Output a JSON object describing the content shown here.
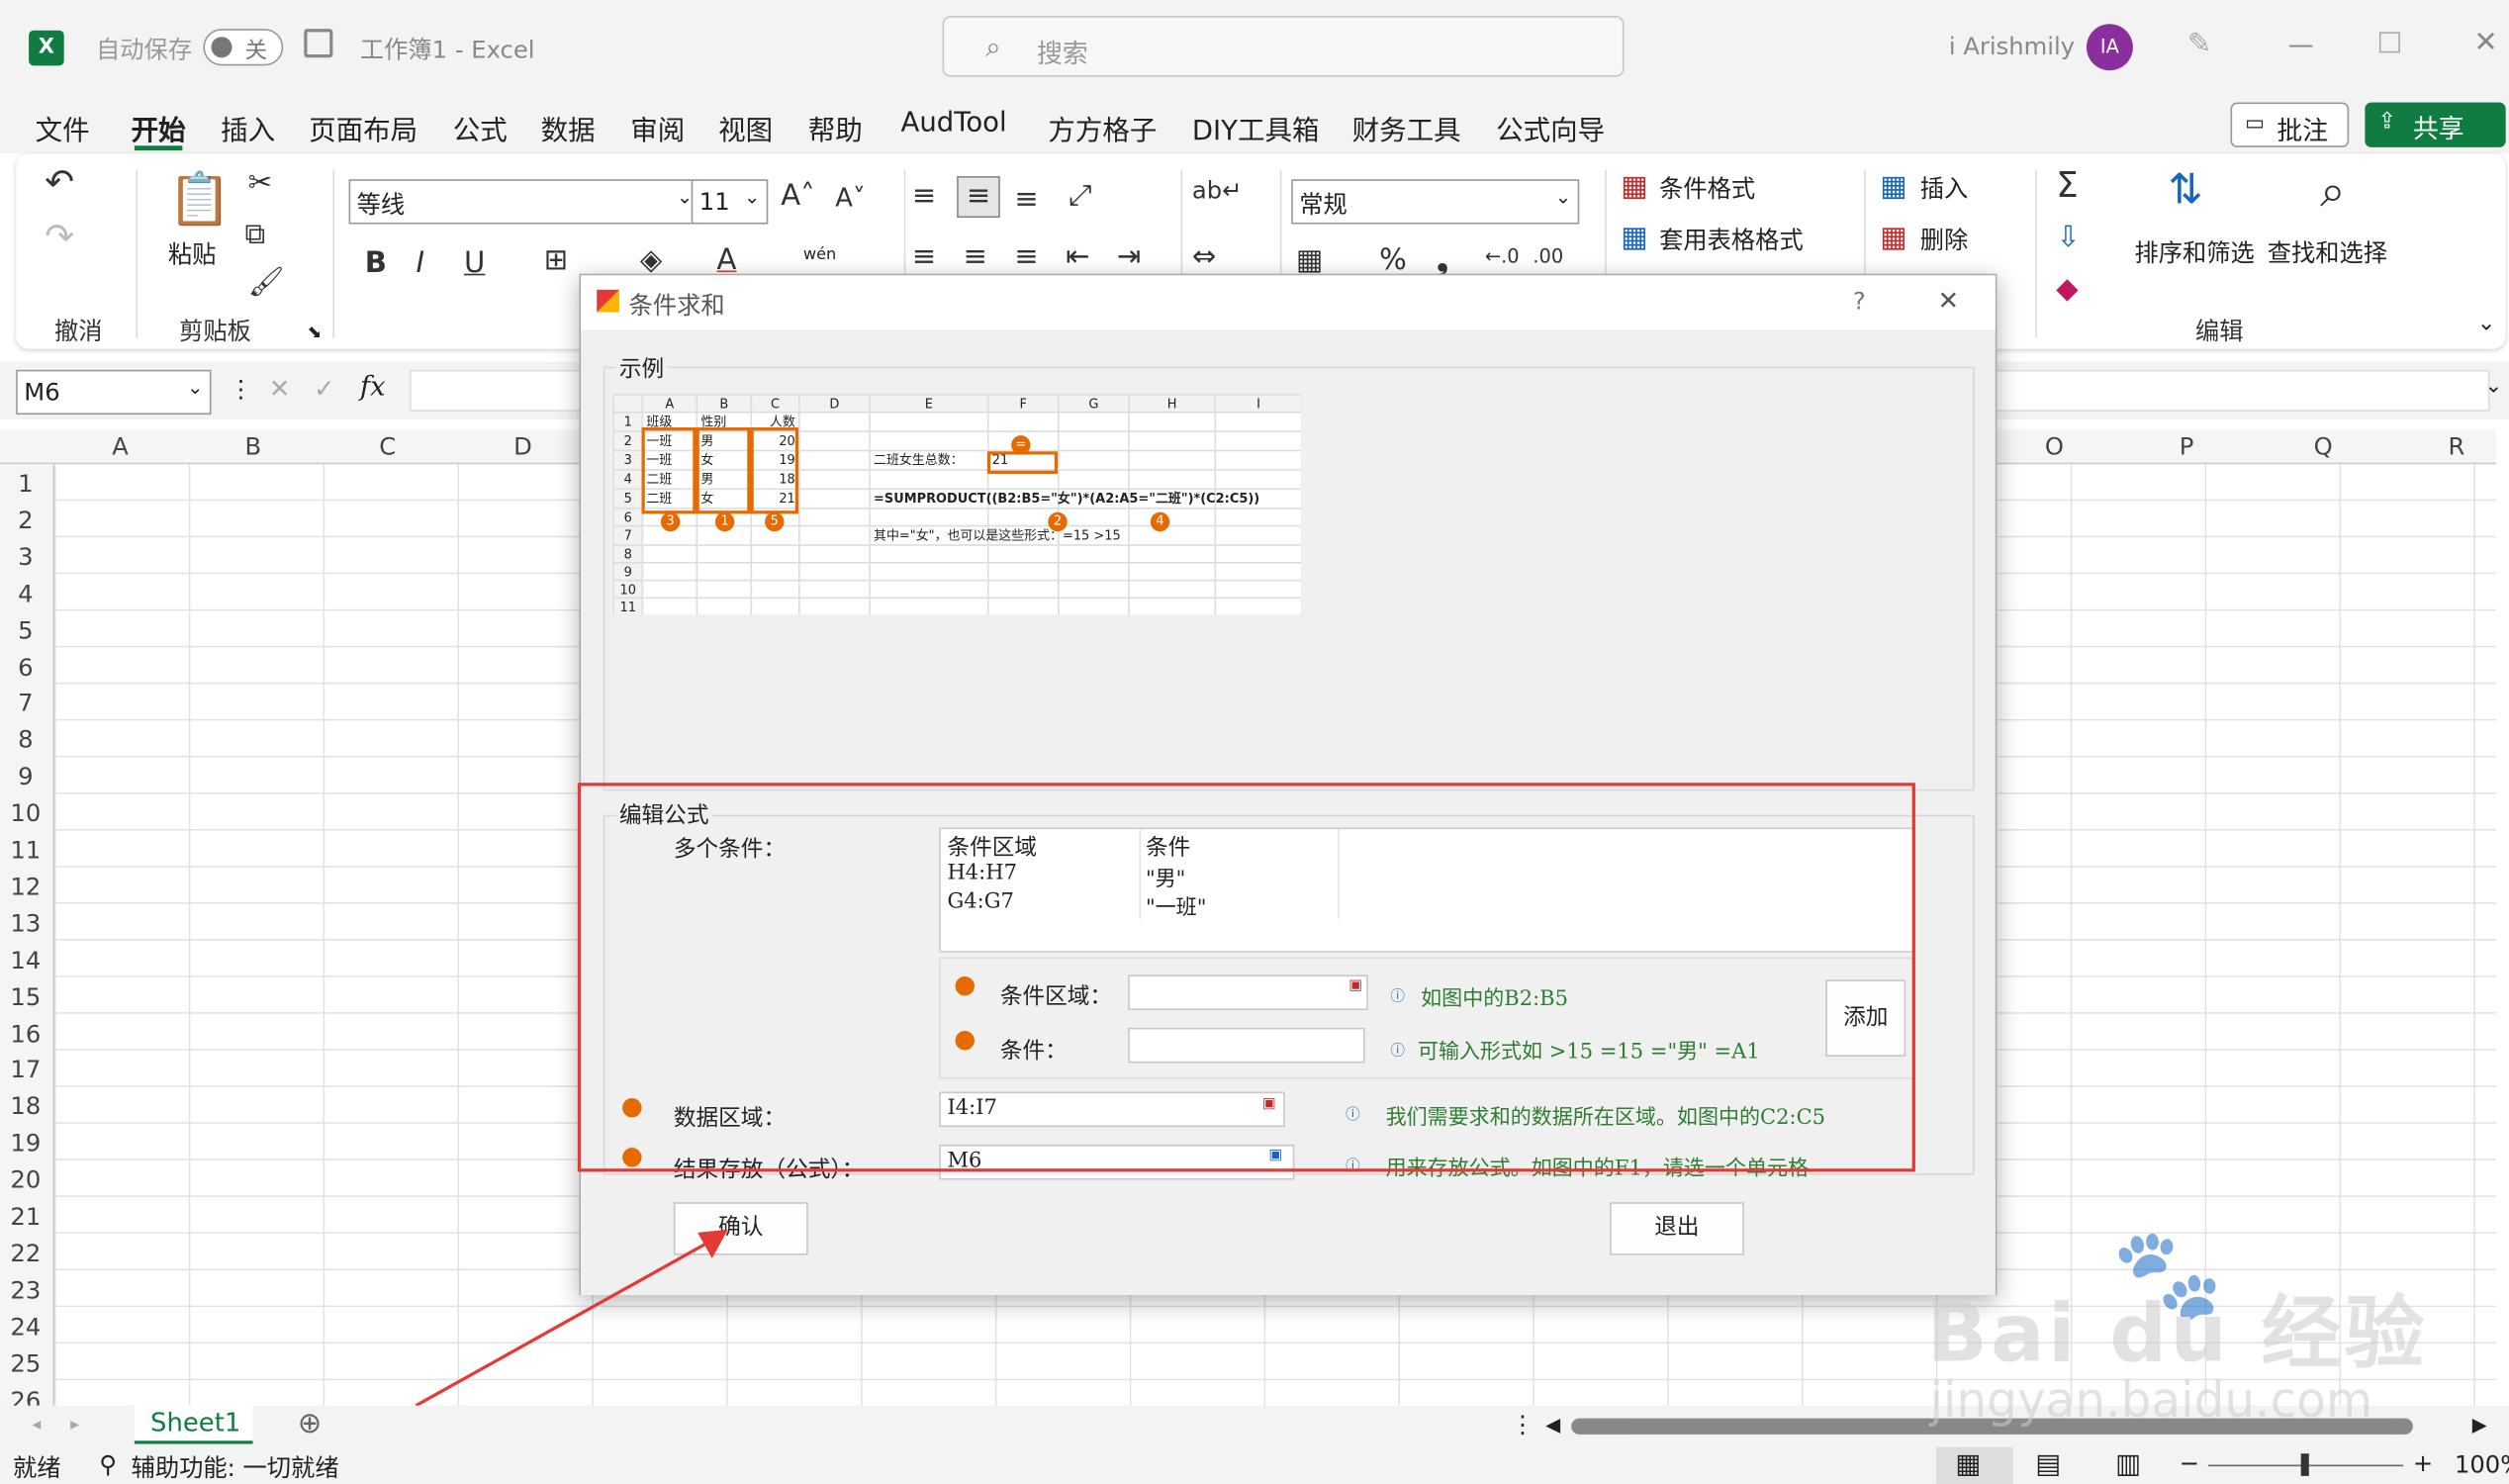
{
  "titlebar": {
    "autosave": "自动保存",
    "toggle": "关",
    "doc_title": "工作簿1 - Excel",
    "search": "搜索",
    "user": "i Arishmily",
    "avatar": "IA"
  },
  "menu": [
    "文件",
    "开始",
    "插入",
    "页面布局",
    "公式",
    "数据",
    "审阅",
    "视图",
    "帮助",
    "AudTool",
    "方方格子",
    "DIY工具箱",
    "财务工具",
    "公式向导"
  ],
  "menu_right": {
    "comment": "批注",
    "share": "共享"
  },
  "ribbon": {
    "undo_group": "撤消",
    "clipboard_group": "剪贴板",
    "paste": "粘贴",
    "font_name": "等线",
    "font_size": "11",
    "number_format": "常规",
    "cond_format": "条件格式",
    "table_format": "套用表格格式",
    "insert": "插入",
    "delete": "删除",
    "sort_filter": "排序和筛选",
    "find_select": "查找和选择",
    "edit_group": "编辑",
    "wen": "wén"
  },
  "formula_bar": {
    "name_box": "M6",
    "fx": "fx"
  },
  "columns": [
    "A",
    "B",
    "C",
    "D",
    "O",
    "P",
    "Q",
    "R"
  ],
  "rows": [
    "1",
    "2",
    "3",
    "4",
    "5",
    "6",
    "7",
    "8",
    "9",
    "10",
    "11",
    "12",
    "13",
    "14",
    "15",
    "16",
    "17",
    "18",
    "19",
    "20",
    "21",
    "22",
    "23",
    "24",
    "25",
    "26"
  ],
  "dialog": {
    "title": "条件求和",
    "help": "?",
    "close": "✕",
    "example_label": "示例",
    "example": {
      "cols": [
        "",
        "A",
        "B",
        "C",
        "D",
        "E",
        "F",
        "G",
        "H",
        "I"
      ],
      "rows": [
        [
          "1",
          "班级",
          "性别",
          "人数",
          "",
          "",
          "",
          "",
          "",
          ""
        ],
        [
          "2",
          "一班",
          "男",
          "20",
          "",
          "",
          "",
          "",
          "",
          ""
        ],
        [
          "3",
          "一班",
          "女",
          "19",
          "",
          "二班女生总数：",
          "21",
          "",
          "",
          ""
        ],
        [
          "4",
          "二班",
          "男",
          "18",
          "",
          "",
          "",
          "",
          "",
          ""
        ],
        [
          "5",
          "二班",
          "女",
          "21",
          "",
          "=SUMPRODUCT((B2:B5=\"女\")*(A2:A5=\"二班\")*(C2:C5))",
          "",
          "",
          "",
          ""
        ],
        [
          "6",
          "",
          "",
          "",
          "",
          "",
          "",
          "",
          "",
          ""
        ],
        [
          "7",
          "",
          "",
          "",
          "",
          "其中=\"女\"，也可以是这些形式：=15      >15",
          "",
          "",
          "",
          ""
        ],
        [
          "8",
          "",
          "",
          "",
          "",
          "",
          "",
          "",
          "",
          ""
        ],
        [
          "9",
          "",
          "",
          "",
          "",
          "",
          "",
          "",
          "",
          ""
        ],
        [
          "10",
          "",
          "",
          "",
          "",
          "",
          "",
          "",
          "",
          ""
        ],
        [
          "11",
          "",
          "",
          "",
          "",
          "",
          "",
          "",
          "",
          ""
        ]
      ],
      "markers": [
        "3",
        "1",
        "5",
        "2",
        "4",
        "="
      ]
    },
    "edit_label": "编辑公式",
    "multi_label": "多个条件：",
    "list_headers": [
      "条件区域",
      "条件"
    ],
    "list_rows": [
      [
        "H4:H7",
        "\"男\""
      ],
      [
        "G4:G7",
        "\"一班\""
      ]
    ],
    "range_label": "条件区域：",
    "range_hint": "如图中的B2:B5",
    "cond_label": "条件：",
    "cond_hint": "可输入形式如 >15  =15  =\"男\"  =A1",
    "add_btn": "添加",
    "data_label": "数据区域：",
    "data_value": "I4:I7",
    "data_hint": "我们需要求和的数据所在区域。如图中的C2:C5",
    "result_label": "结果存放（公式）：",
    "result_value": "M6",
    "result_hint": "用来存放公式。如图中的F1，请选一个单元格",
    "ok_btn": "确认",
    "exit_btn": "退出"
  },
  "sheet_tab": "Sheet1",
  "status": {
    "ready": "就绪",
    "access": "辅助功能: 一切就绪",
    "zoom": "100%"
  },
  "watermark": {
    "brand": "Bai du 经验",
    "url": "jingyan.baidu.com"
  },
  "colors": {
    "excel_green": "#107c41",
    "accent_orange": "#e56b00",
    "highlight_red": "#e53935",
    "hint_green": "#2e7d32"
  }
}
